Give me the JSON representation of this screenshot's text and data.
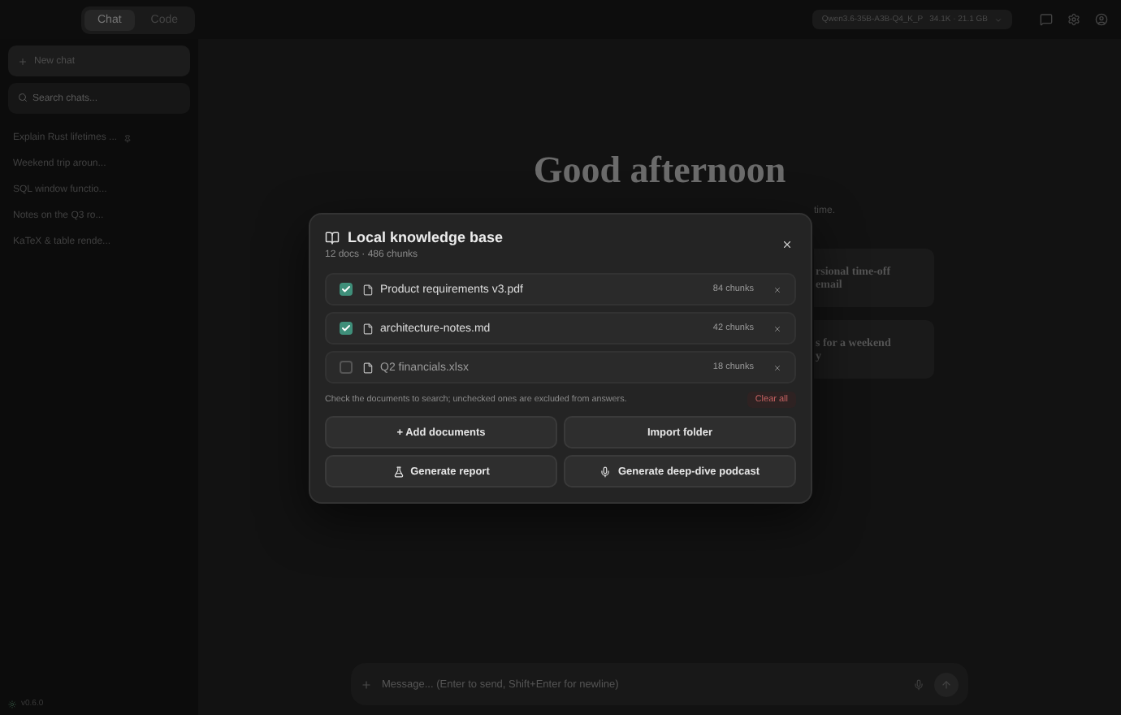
{
  "top_bar": {
    "tabs": [
      {
        "label": "Chat",
        "selected": true
      },
      {
        "label": "Code",
        "selected": false
      }
    ],
    "model": "Qwen3.6-35B-A3B-Q4_K_P",
    "model_meta": "34.1K · 21.1 GB"
  },
  "sidebar": {
    "new_chat": "New chat",
    "search": {
      "placeholder": "Search chats..."
    },
    "items": [
      {
        "label": "Explain Rust lifetimes ...",
        "pinned": true
      },
      {
        "label": "Weekend trip aroun...",
        "pinned": false
      },
      {
        "label": "SQL window functio...",
        "pinned": false
      },
      {
        "label": "Notes on the Q3 ro...",
        "pinned": false
      },
      {
        "label": "KaTeX & table rende...",
        "pinned": false
      }
    ],
    "version": "v0.6.0"
  },
  "main": {
    "greeting": "Good afternoon",
    "subtitle_fragment": "time.",
    "suggestions": [
      {
        "line_1": "rsional time-off",
        "line_2": "email"
      },
      {
        "line_1": "s for a weekend",
        "line_2": "y"
      }
    ],
    "composer": {
      "placeholder": "Message... (Enter to send, Shift+Enter for newline)"
    }
  },
  "dialog": {
    "title": "Local knowledge base",
    "subtitle": "12 docs · 486 chunks",
    "documents": [
      {
        "name": "Product requirements v3.pdf",
        "chunks": "84 chunks",
        "checked": true
      },
      {
        "name": "architecture-notes.md",
        "chunks": "42 chunks",
        "checked": true
      },
      {
        "name": "Q2 financials.xlsx",
        "chunks": "18 chunks",
        "checked": false
      }
    ],
    "hint": "Check the documents to search; unchecked ones are excluded from answers.",
    "clear_all": "Clear all",
    "buttons": [
      {
        "label": "+ Add documents",
        "kind": "plain"
      },
      {
        "label": "Import folder",
        "kind": "plain"
      },
      {
        "label": "Generate report",
        "kind": "report"
      },
      {
        "label": "Generate deep-dive podcast",
        "kind": "podcast"
      }
    ]
  }
}
